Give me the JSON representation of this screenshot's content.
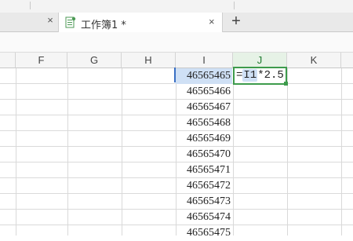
{
  "tabbar": {
    "prev_close_symbol": "×",
    "tab_label": "工作簿1 *",
    "tab_close_symbol": "×",
    "new_tab_symbol": "+"
  },
  "columns": [
    {
      "label": "F",
      "active": false
    },
    {
      "label": "G",
      "active": false
    },
    {
      "label": "H",
      "active": false
    },
    {
      "label": "I",
      "active": false
    },
    {
      "label": "J",
      "active": true
    },
    {
      "label": "K",
      "active": false
    }
  ],
  "column_i_values": [
    "46565465",
    "46565466",
    "46565467",
    "46565468",
    "46565469",
    "46565470",
    "46565471",
    "46565472",
    "46565473",
    "46565474",
    "46565475"
  ],
  "formula": {
    "prefix": "=",
    "reference": "I1",
    "suffix": "*2.5"
  },
  "colors": {
    "active_border": "#3d9b4c",
    "reference_highlight": "#cfe0f5",
    "reference_bar": "#3a6fc4"
  },
  "icons": [
    "close-icon",
    "spreadsheet-doc-icon",
    "plus-icon"
  ]
}
